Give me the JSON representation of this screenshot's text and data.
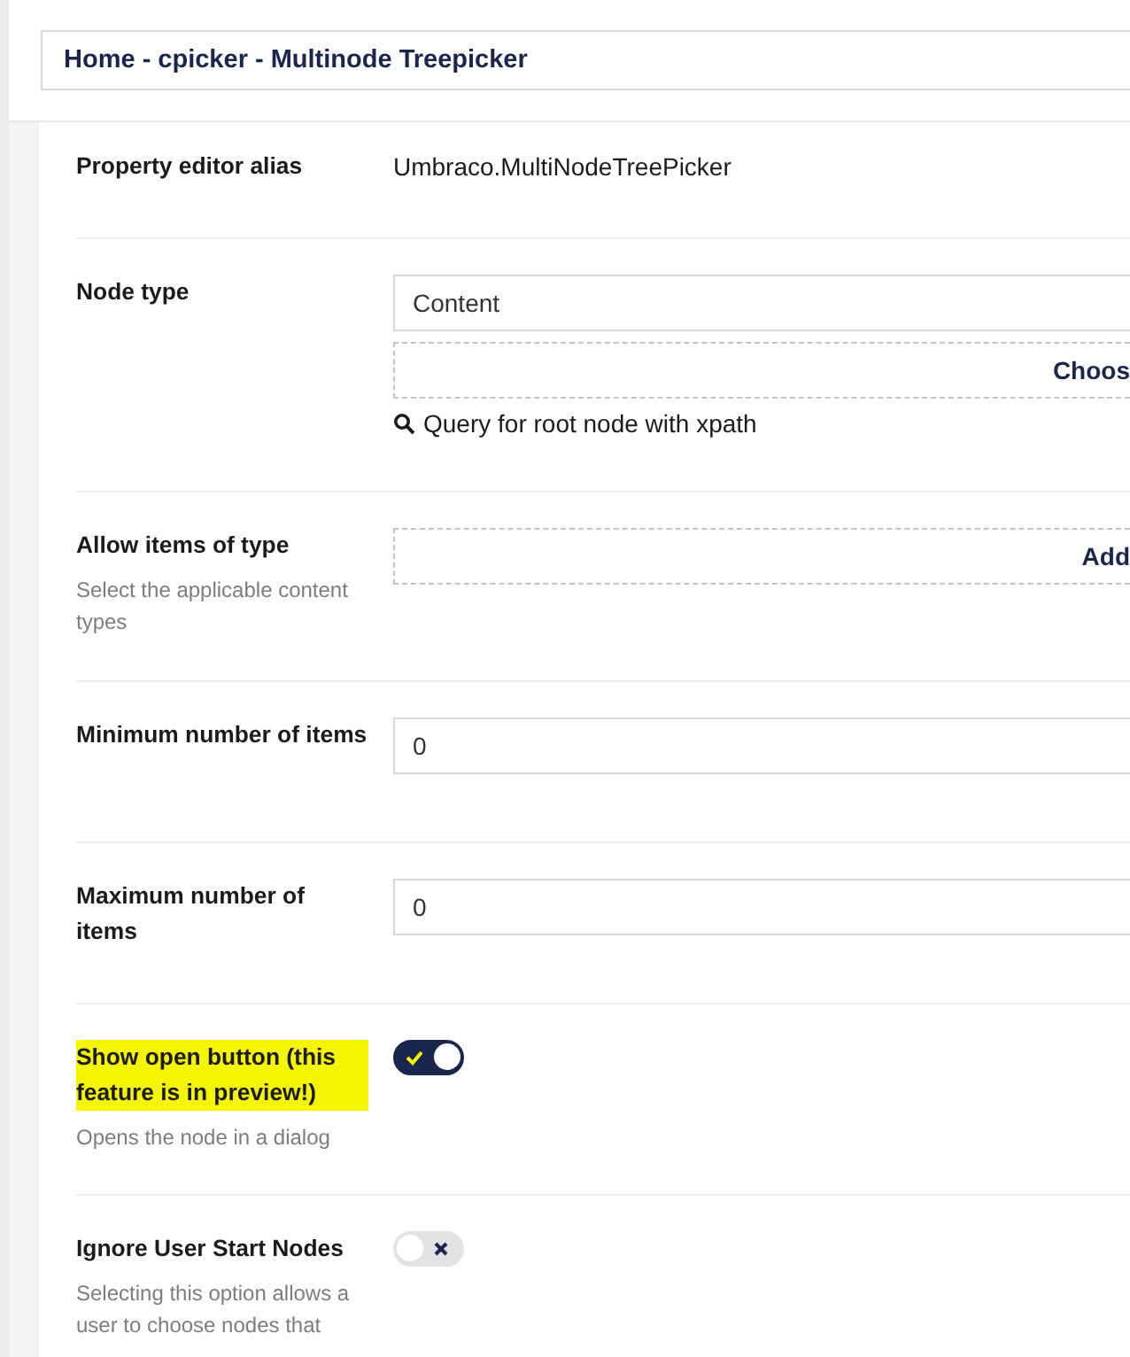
{
  "header": {
    "title_value": "Home - cpicker - Multinode Treepicker"
  },
  "properties": [
    {
      "kind": "text",
      "label": "Property editor alias",
      "value": "Umbraco.MultiNodeTreePicker"
    },
    {
      "kind": "nodetype",
      "label": "Node type",
      "select_value": "Content",
      "choose_label": "Choos",
      "query_link": "Query for root node with xpath"
    },
    {
      "kind": "add",
      "label": "Allow items of type",
      "description": "Select the applicable content types",
      "add_label": "Add"
    },
    {
      "kind": "number",
      "label": "Minimum number of items",
      "value": "0"
    },
    {
      "kind": "number",
      "label": "Maximum number of items",
      "value": "0"
    },
    {
      "kind": "toggle",
      "label": "Show open button (this feature is in preview!)",
      "highlighted": true,
      "description": "Opens the node in a dialog",
      "on": true
    },
    {
      "kind": "toggle",
      "label": "Ignore User Start Nodes",
      "highlighted": false,
      "description": "Selecting this option allows a user to choose nodes that",
      "on": false
    }
  ]
}
